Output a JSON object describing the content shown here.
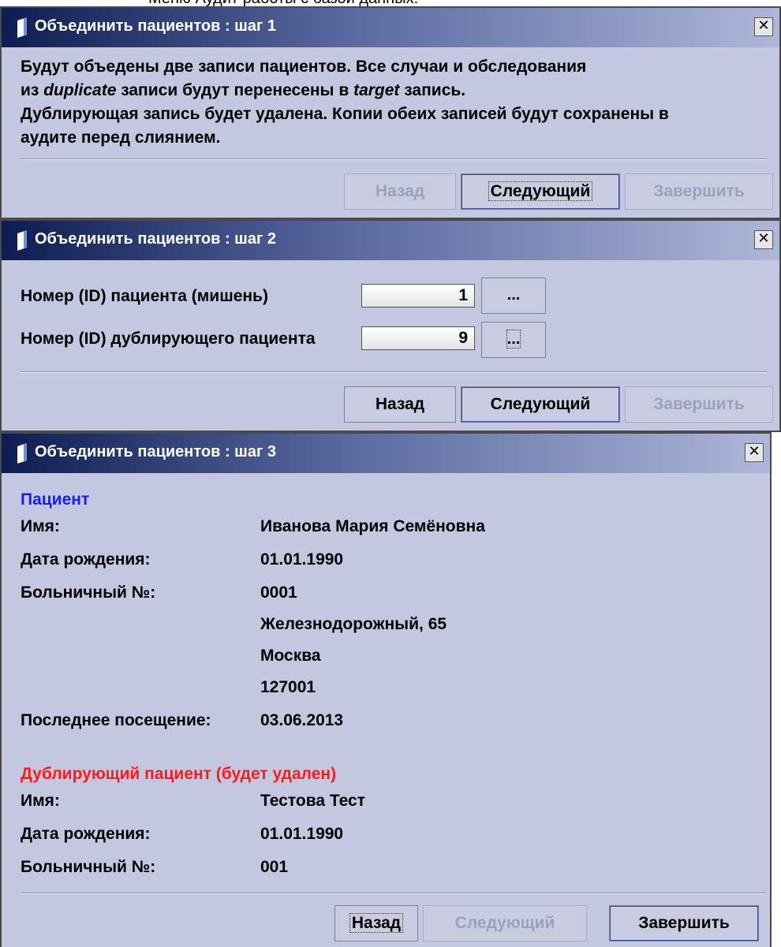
{
  "background_caption": "Меню Аудит работы с базой данных.",
  "colors": {
    "dialog_bg": "#c3c8e0",
    "title_gradient_start": "#0d1d52",
    "patient_heading": "#1a1aff",
    "duplicate_heading": "#ff1a1a",
    "disabled_text": "#9aa0c0"
  },
  "step1": {
    "title": "Объединить пациентов : шаг 1",
    "close": "✕",
    "text": {
      "l1": "Будут объедены две записи пациентов. Все случаи и обследования",
      "l2_a": "из ",
      "l2_em1": "duplicate",
      "l2_b": " записи будут перенесены в ",
      "l2_em2": "target",
      "l2_c": " запись.",
      "l3": "Дублирующая запись будет удалена. Копии обеих записей будут сохранены в",
      "l4": "аудите перед слиянием."
    },
    "buttons": {
      "back": "Назад",
      "next": "Следующий",
      "finish": "Завершить"
    }
  },
  "step2": {
    "title": "Объединить пациентов : шаг 2",
    "close": "✕",
    "target_label": "Номер (ID) пациента (мишень)",
    "target_value": "1",
    "duplicate_label": "Номер (ID) дублирующего пациента",
    "duplicate_value": "9",
    "browse": "...",
    "buttons": {
      "back": "Назад",
      "next": "Следующий",
      "finish": "Завершить"
    }
  },
  "step3": {
    "title": "Объединить пациентов : шаг 3",
    "close": "✕",
    "patient": {
      "heading": "Пациент",
      "name_label": "Имя:",
      "name": "Иванова Мария Семёновна",
      "dob_label": "Дата рождения:",
      "dob": "01.01.1990",
      "hosp_label": "Больничный №:",
      "hosp": "0001",
      "address1": "Железнодорожный, 65",
      "address2": "Москва",
      "address3": "127001",
      "last_visit_label": "Последнее посещение:",
      "last_visit": "03.06.2013"
    },
    "duplicate": {
      "heading": "Дублирующий пациент (будет удален)",
      "name_label": "Имя:",
      "name": "Тестова Тест",
      "dob_label": "Дата рождения:",
      "dob": "01.01.1990",
      "hosp_label": "Больничный №:",
      "hosp": "001"
    },
    "buttons": {
      "back": "Назад",
      "next": "Следующий",
      "finish": "Завершить"
    }
  }
}
